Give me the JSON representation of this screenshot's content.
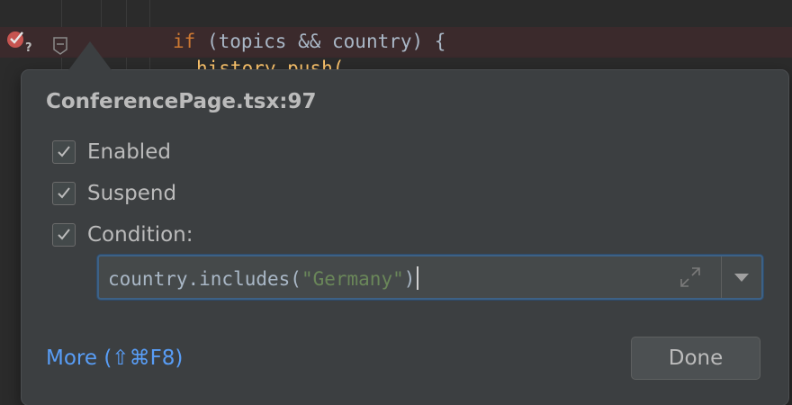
{
  "editor": {
    "code_line_1_keyword": "if",
    "code_line_1_rest": " (topics && country) {",
    "code_line_2_fn": "history.push(",
    "code_line_2_prefix": ""
  },
  "popup": {
    "title": "ConferencePage.tsx:97",
    "checkboxes": [
      {
        "label": "Enabled",
        "checked": true
      },
      {
        "label": "Suspend",
        "checked": true
      },
      {
        "label": "Condition:",
        "checked": true
      }
    ],
    "condition": {
      "prefix": "country.includes(",
      "string": "\"Germany\"",
      "suffix": ")"
    },
    "more_link": "More (⇧⌘F8)",
    "done_button": "Done"
  },
  "icons": {
    "breakpoint": "breakpoint-conditional-icon",
    "fold": "fold-marker-icon",
    "expand": "expand-icon",
    "dropdown": "chevron-down-icon",
    "check": "check-icon"
  },
  "colors": {
    "accent_link": "#589df6",
    "keyword": "#cc7832",
    "string": "#6a8759",
    "function": "#ffc66d",
    "breakpoint": "#c75450"
  }
}
